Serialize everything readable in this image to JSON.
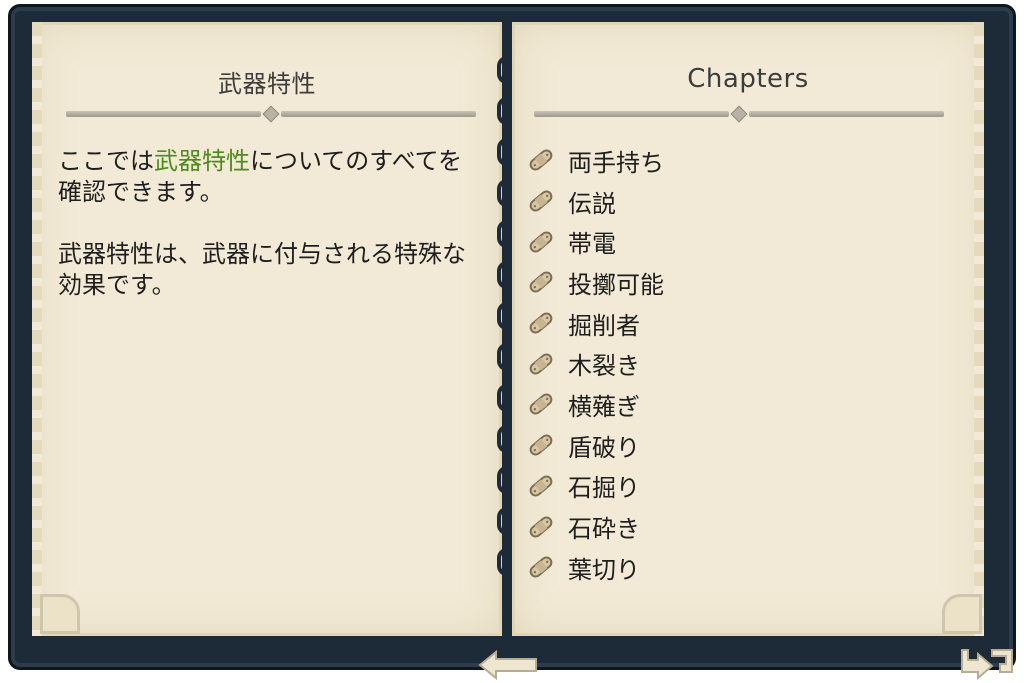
{
  "left_page": {
    "title": "武器特性",
    "intro_prefix": "ここでは",
    "intro_highlight": "武器特性",
    "intro_suffix": "についてのすべてを確認できます。",
    "paragraph2": "武器特性は、武器に付与される特殊な効果です。"
  },
  "right_page": {
    "title": "Chapters",
    "chapters": [
      {
        "label": "両手持ち"
      },
      {
        "label": "伝説"
      },
      {
        "label": "帯電"
      },
      {
        "label": "投擲可能"
      },
      {
        "label": "掘削者"
      },
      {
        "label": "木裂き"
      },
      {
        "label": "横薙ぎ"
      },
      {
        "label": "盾破り"
      },
      {
        "label": "石掘り"
      },
      {
        "label": "石砕き"
      },
      {
        "label": "葉切り"
      }
    ]
  },
  "colors": {
    "frame": "#1d2b38",
    "page": "#f2ead6",
    "highlight": "#4f8a1c",
    "text": "#1e1e1e"
  },
  "icons": {
    "chapter_icon": "bandage-icon",
    "back": "back-arrow-icon",
    "close": "return-arrow-icon"
  }
}
